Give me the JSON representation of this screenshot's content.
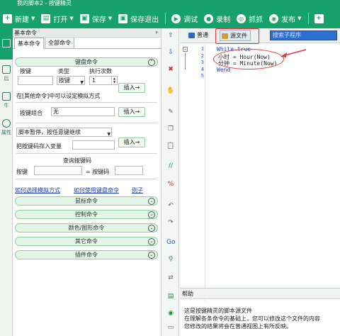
{
  "title": "我的脚本2 - 按键精灵",
  "toolbar": [
    {
      "icon": "plus-icon",
      "glyph": "+",
      "label": "新建",
      "drop": true
    },
    {
      "icon": "folder-open-icon",
      "glyph": "▤",
      "label": "打开",
      "drop": true
    },
    {
      "icon": "save-icon",
      "glyph": "▣",
      "label": "保存",
      "drop": true
    },
    {
      "icon": "save-exit-icon",
      "glyph": "▣",
      "label": "保存退出",
      "drop": false
    },
    {
      "icon": "debug-icon",
      "glyph": "▶",
      "label": "调试",
      "drop": false
    },
    {
      "icon": "record-icon",
      "glyph": "●",
      "label": "录制",
      "drop": false
    },
    {
      "icon": "capture-icon",
      "glyph": "◎",
      "label": "抓抓",
      "drop": false
    },
    {
      "icon": "publish-icon",
      "glyph": "◉",
      "label": "发布",
      "drop": true
    },
    {
      "icon": "plus-box-icon",
      "glyph": "+",
      "label": "",
      "drop": false
    }
  ],
  "left_strip": {
    "items": [
      {
        "label": ""
      },
      {
        "label": "后"
      },
      {
        "label": "牛"
      },
      {
        "label": "属性"
      }
    ]
  },
  "panel": {
    "header": "基本命令",
    "pin": "ᵖ",
    "tabs": [
      "基本命令",
      "全部命令"
    ],
    "keyboard": {
      "section": "键盘命令",
      "key_label": "按键",
      "type_label": "类型",
      "count_label": "执行次数",
      "key_value": "",
      "type_value": "按键",
      "count_value": "1",
      "insert": "插入→",
      "note": "在[其他命令]中可以设定模拟方式",
      "combo_label": "按键组合",
      "combo_value": "无",
      "combo_insert": "插入→"
    },
    "pause": {
      "select": "脚本暂停，按任意键继续",
      "store_label": "把按键码存入变量",
      "store_value": "",
      "insert": "插入→"
    },
    "query": {
      "title": "查询按键码",
      "key_label": "按键",
      "eq_label": "= 按键码",
      "key_value": "",
      "code_value": ""
    },
    "links": [
      "如何选择模拟方式",
      "如何使用键盘命令",
      "例子"
    ],
    "sections": [
      "鼠标命令",
      "控制命令",
      "颜色/图形命令",
      "其它命令",
      "插件命令"
    ]
  },
  "editor": {
    "tab_normal": "普通",
    "tab_source": "源文件",
    "search_placeholder": "搜索子程序",
    "lines": [
      {
        "num": "1",
        "parts": [
          {
            "t": "While ",
            "c": "kw"
          },
          {
            "t": "true",
            "c": "kw"
          }
        ]
      },
      {
        "num": "2",
        "parts": [
          {
            "t": "小时 = Hour(Now)",
            "c": "stm"
          }
        ]
      },
      {
        "num": "3",
        "parts": [
          {
            "t": "分钟 = Minute(Now)",
            "c": "stm"
          }
        ]
      },
      {
        "num": "4",
        "parts": [
          {
            "t": "Wend",
            "c": "kw"
          }
        ]
      },
      {
        "num": "5",
        "parts": []
      }
    ],
    "help_title": "帮助",
    "help_lines": [
      "这是按键精灵的脚本源文件",
      "在理解各条命令的基础上，您可以修改这个文件的内容",
      "您修改的结果将会在普通视图上有所反映。"
    ]
  },
  "vertical_tools": [
    {
      "icon": "up-icon",
      "glyph": "⇧"
    },
    {
      "icon": "down-icon",
      "glyph": "⇩"
    },
    {
      "icon": "delete-icon",
      "glyph": "✖"
    },
    {
      "icon": "hand-icon",
      "glyph": "✋"
    },
    {
      "icon": "paint-icon",
      "glyph": "✎"
    },
    {
      "icon": "copy-icon",
      "glyph": "❐"
    },
    {
      "icon": "paste-icon",
      "glyph": "📋"
    },
    {
      "icon": "comment-icon",
      "glyph": "//"
    },
    {
      "icon": "uncomment-icon",
      "glyph": "%"
    },
    {
      "icon": "undo-icon",
      "glyph": "↶"
    },
    {
      "icon": "redo-icon",
      "glyph": "↷"
    },
    {
      "icon": "goto-icon",
      "glyph": "Go"
    },
    {
      "icon": "find-icon",
      "glyph": "⚲"
    },
    {
      "icon": "replace-icon",
      "glyph": "⇄"
    },
    {
      "icon": "bookmark-icon",
      "glyph": "▤"
    },
    {
      "icon": "eye-icon",
      "glyph": "◉"
    },
    {
      "icon": "screen-icon",
      "glyph": "▭"
    }
  ],
  "colors": {
    "accent": "#17a16b",
    "annotation": "#e03a3a",
    "keyword": "#1a3fbf"
  }
}
